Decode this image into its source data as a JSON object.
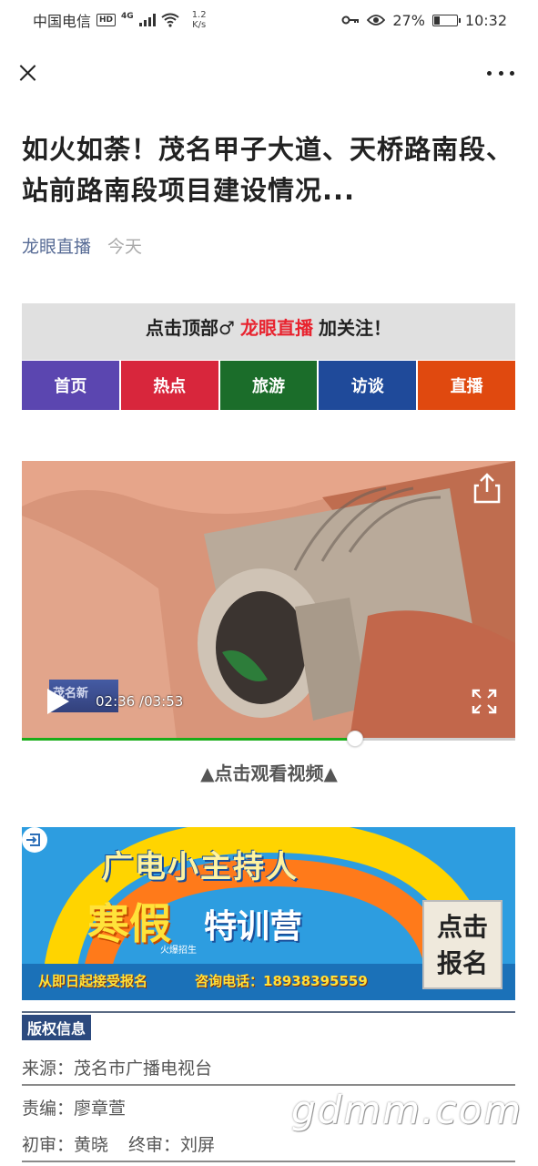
{
  "status_bar": {
    "carrier": "中国电信",
    "hd": "HD",
    "network": "4G",
    "speed_value": "1.2",
    "speed_unit": "K/s",
    "battery_percent": "27%",
    "battery_level": 0.27,
    "time": "10:32"
  },
  "article": {
    "title": "如火如荼！茂名甲子大道、天桥路南段、站前路南段项目建设情况...",
    "author": "龙眼直播",
    "date": "今天"
  },
  "follow_banner": {
    "prefix": "点击顶部♂",
    "account": "龙眼直播",
    "suffix": "加关注！"
  },
  "menu_tabs": [
    {
      "label": "首页",
      "color": "#5b46b0"
    },
    {
      "label": "热点",
      "color": "#d8263c"
    },
    {
      "label": "旅游",
      "color": "#1b6d2a"
    },
    {
      "label": "访谈",
      "color": "#1f4a9a"
    },
    {
      "label": "直播",
      "color": "#e0490f"
    }
  ],
  "video": {
    "current_time": "02:36",
    "duration": "/03:53",
    "progress": 0.675,
    "logo_text": "茂名新",
    "hint": "▲点击观看视频▲"
  },
  "ad": {
    "title": "广电小主持人",
    "sub1": "寒假",
    "sub2": "特训营",
    "tag": "火爆招生",
    "line": "从即日起接受报名",
    "phone": "咨询电话：18938395559",
    "cta_line1": "点击",
    "cta_line2": "报名"
  },
  "copyright": {
    "heading": "版权信息",
    "source": "来源：茂名市广播电视台",
    "editor": "责编：廖章萱",
    "first_review": "初审：黄晓",
    "final_review": "终审：刘屏"
  },
  "watermark": "gdmm.com"
}
